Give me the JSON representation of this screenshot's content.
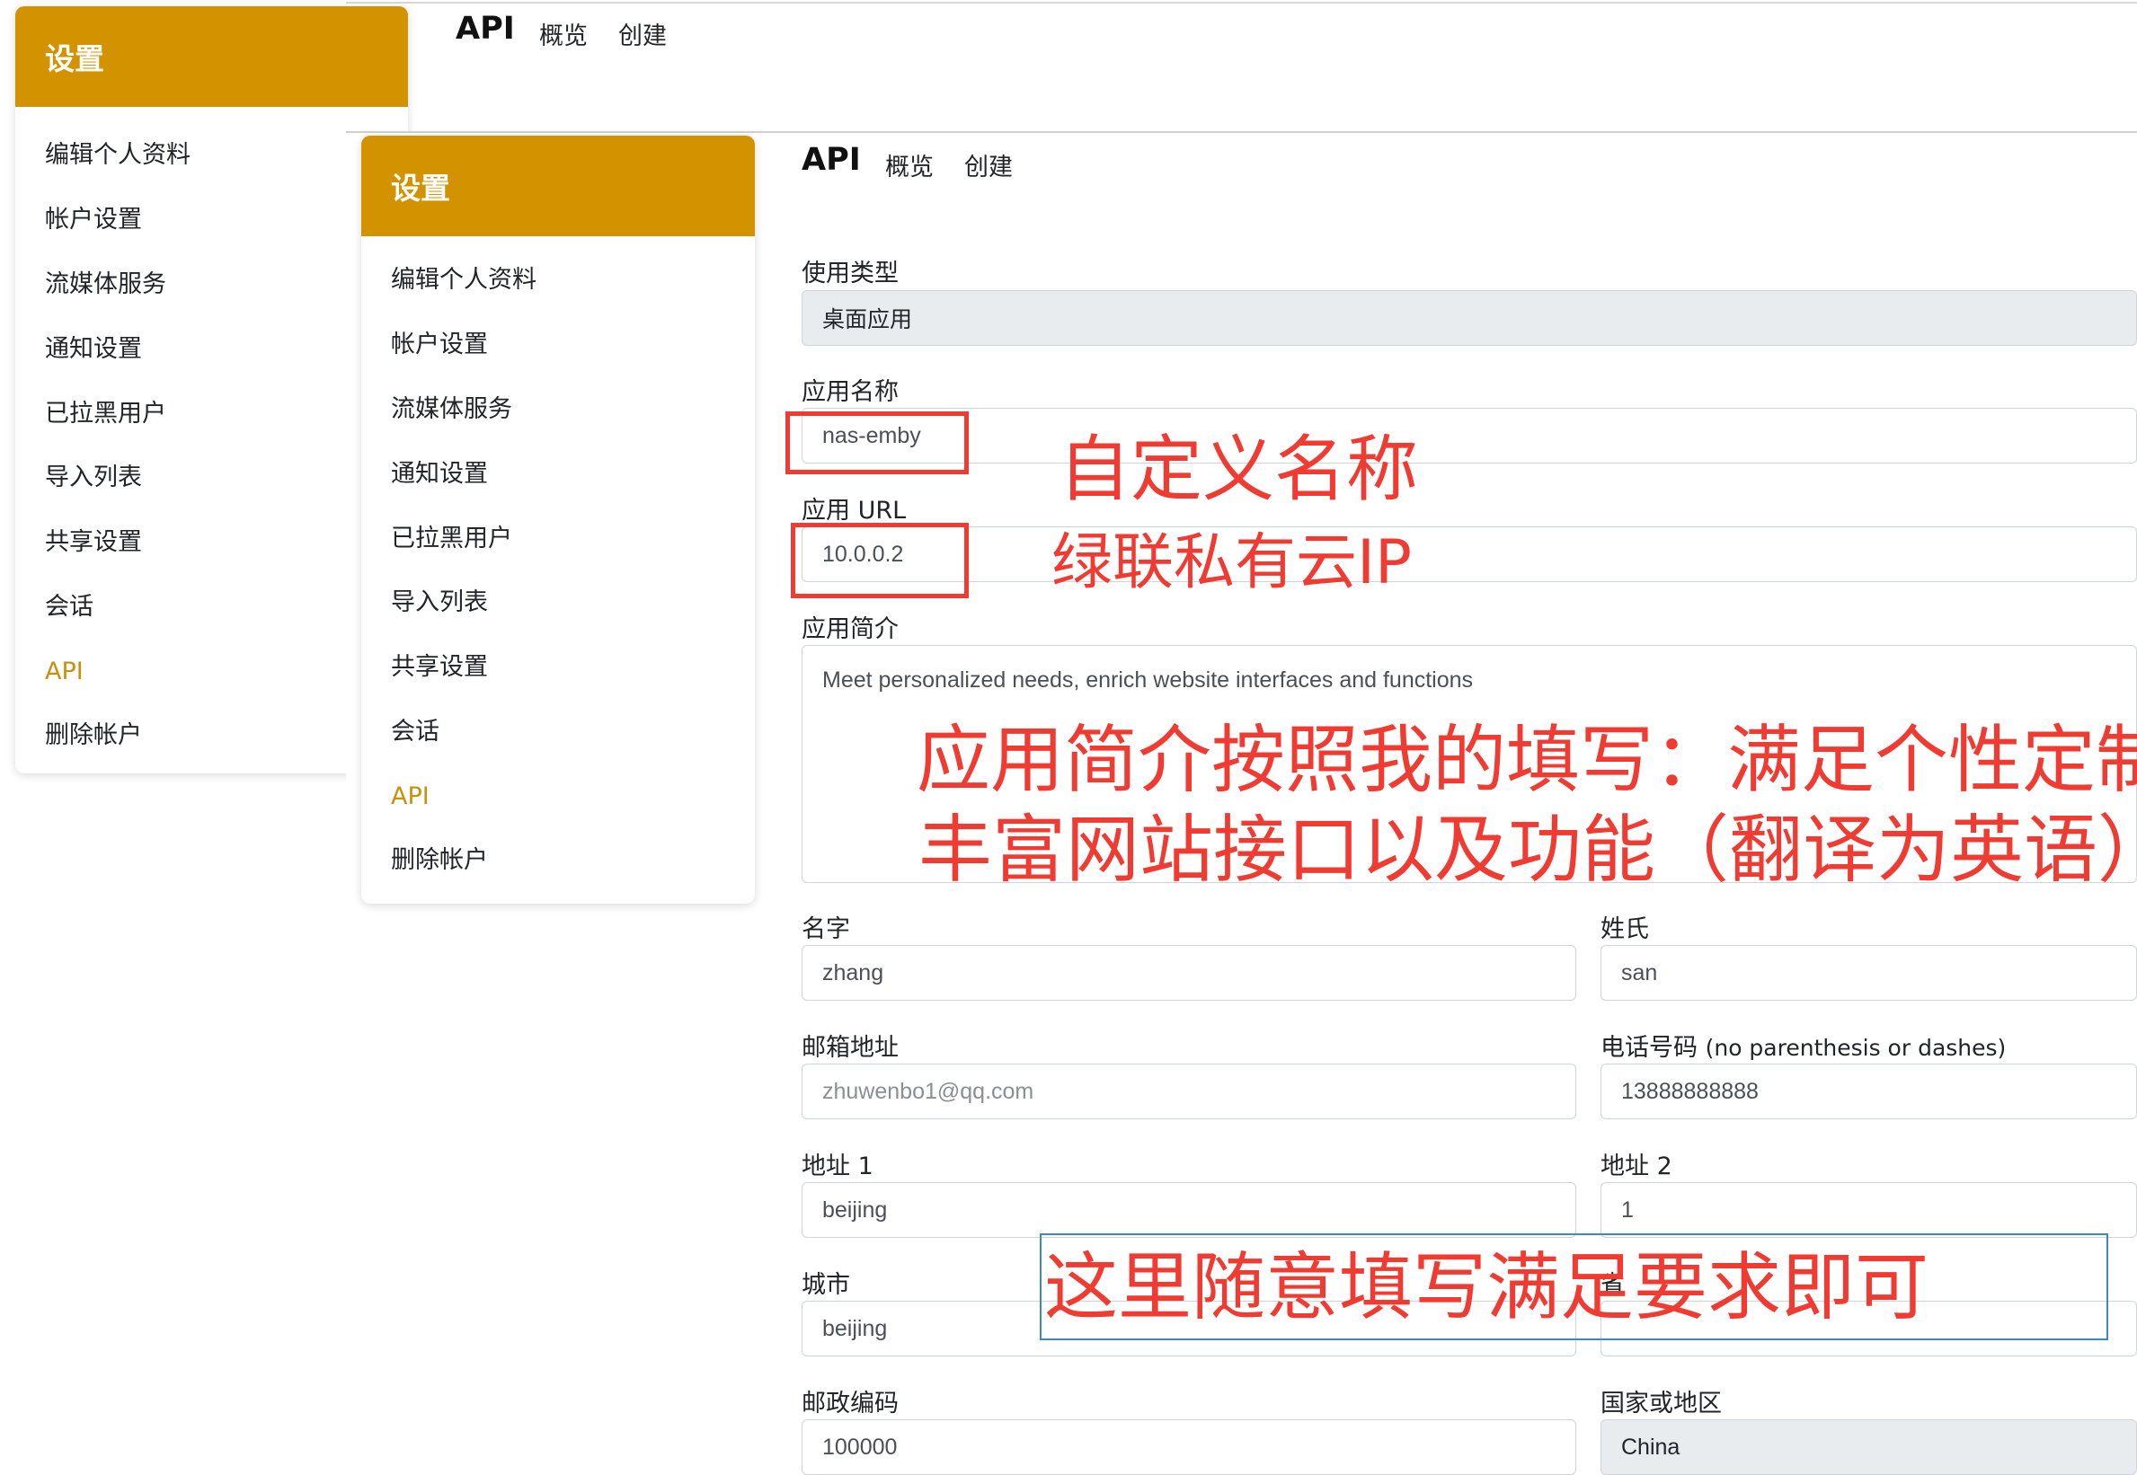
{
  "colors": {
    "accent": "#d39300",
    "annotation": "#ef3b31",
    "annotation_box_blue": "#3a86d4"
  },
  "back": {
    "header": "设置",
    "nav": {
      "title": "API",
      "links": [
        "概览",
        "创建"
      ]
    },
    "menu": [
      "编辑个人资料",
      "帐户设置",
      "流媒体服务",
      "通知设置",
      "已拉黑用户",
      "导入列表",
      "共享设置",
      "会话",
      "API",
      "删除帐户"
    ]
  },
  "front": {
    "header": "设置",
    "nav": {
      "title": "API",
      "links": [
        "概览",
        "创建"
      ]
    },
    "menu": [
      "编辑个人资料",
      "帐户设置",
      "流媒体服务",
      "通知设置",
      "已拉黑用户",
      "导入列表",
      "共享设置",
      "会话",
      "API",
      "删除帐户"
    ],
    "active_menu": "API",
    "form": {
      "usage_type": {
        "label": "使用类型",
        "value": "桌面应用"
      },
      "app_name": {
        "label": "应用名称",
        "value": "nas-emby"
      },
      "app_url": {
        "label": "应用 URL",
        "value": "10.0.0.2"
      },
      "app_desc": {
        "label": "应用简介",
        "value": "Meet personalized needs, enrich website interfaces and functions"
      },
      "first_name": {
        "label": "名字",
        "value": "zhang"
      },
      "last_name": {
        "label": "姓氏",
        "value": "san"
      },
      "email": {
        "label": "邮箱地址",
        "value": "zhuwenbo1@qq.com"
      },
      "phone": {
        "label": "电话号码",
        "label_note": "(no parenthesis or dashes)",
        "value": "13888888888"
      },
      "address1": {
        "label": "地址 1",
        "value": "beijing"
      },
      "address2": {
        "label": "地址 2",
        "value": "1"
      },
      "city": {
        "label": "城市",
        "value": "beijing"
      },
      "province": {
        "label": "省"
      },
      "postal": {
        "label": "邮政编码",
        "value": "100000"
      },
      "country": {
        "label": "国家或地区",
        "value": "China"
      }
    }
  },
  "annotations": {
    "name_note": "自定义名称",
    "ip_note": "绿联私有云IP",
    "desc_note_line1": "应用简介按照我的填写：满足个性定制",
    "desc_note_line2": "丰富网站接口以及功能（翻译为英语）",
    "free_fill_note": "这里随意填写满足要求即可"
  }
}
